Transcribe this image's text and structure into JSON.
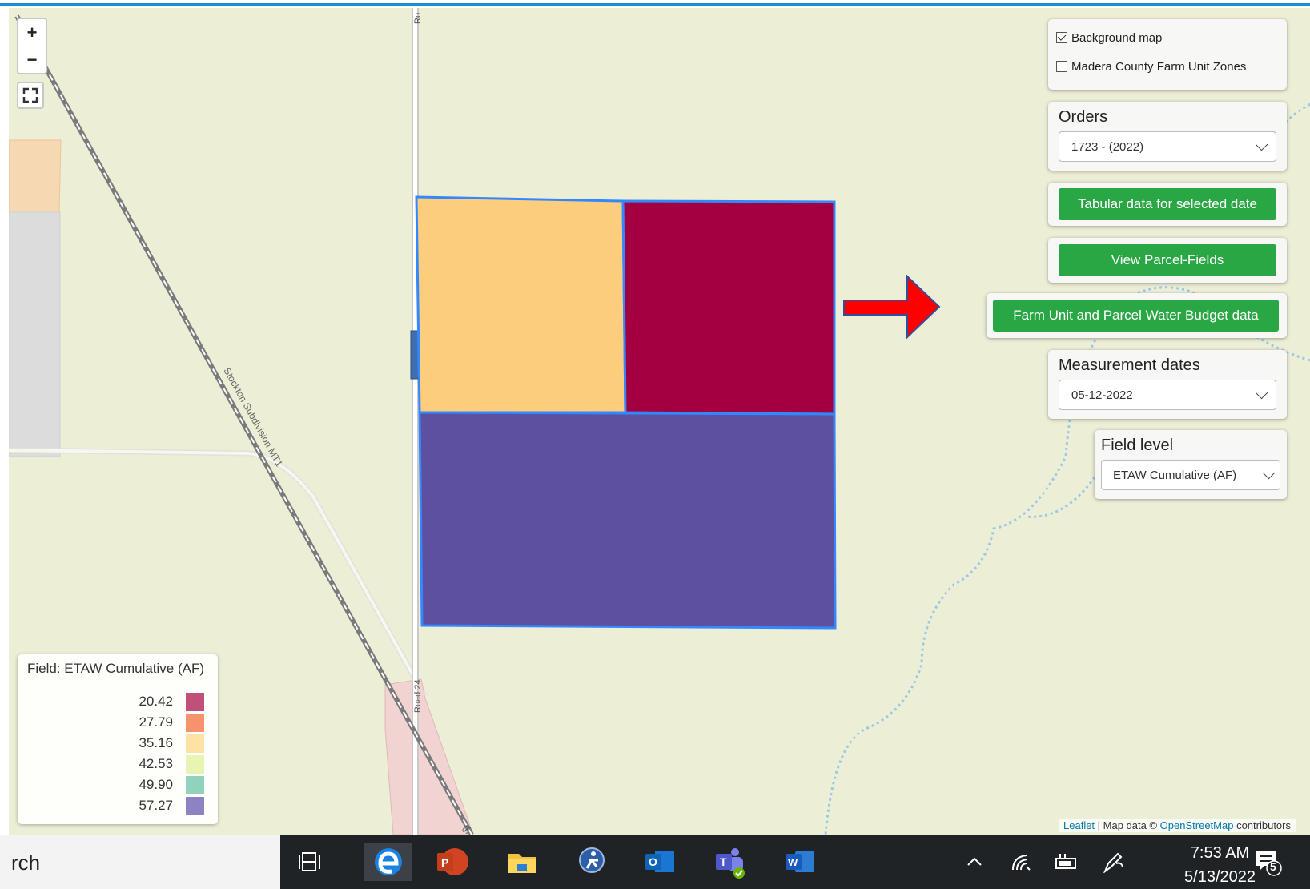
{
  "layers": {
    "background_map": {
      "label": "Background map",
      "checked": true
    },
    "farm_unit_zones": {
      "label": "Madera County Farm Unit Zones",
      "checked": false
    }
  },
  "orders": {
    "title": "Orders",
    "selected": "1723 - (2022)"
  },
  "buttons": {
    "tabular": "Tabular data for selected date",
    "parcel_fields": "View Parcel-Fields",
    "water_budget": "Farm Unit and Parcel Water Budget data"
  },
  "measurement": {
    "title": "Measurement dates",
    "selected": "05-12-2022"
  },
  "field_level": {
    "title": "Field level",
    "selected": "ETAW Cumulative (AF)"
  },
  "zoom": {
    "in": "+",
    "out": "−"
  },
  "map_labels": {
    "railway": "Stockton Subdivision MT1",
    "road": "Road 24",
    "road_top": "Ro",
    "road_bottom": "St",
    "corner": "vis"
  },
  "legend": {
    "title": "Field: ETAW Cumulative (AF)",
    "items": [
      {
        "value": "20.42",
        "color": "#c0507a"
      },
      {
        "value": "27.79",
        "color": "#f7936c"
      },
      {
        "value": "35.16",
        "color": "#fde2a4"
      },
      {
        "value": "42.53",
        "color": "#e8f4b2"
      },
      {
        "value": "49.90",
        "color": "#8fd3bd"
      },
      {
        "value": "57.27",
        "color": "#8c84c2"
      }
    ]
  },
  "fields_colors": {
    "top_left": "#fdcd7e",
    "top_right": "#a20040",
    "bottom": "#5e50a1",
    "outline": "#3388ff"
  },
  "attribution": {
    "leaflet": "Leaflet",
    "sep": " | Map data © ",
    "osm": "OpenStreetMap",
    "contrib": " contributors"
  },
  "taskbar": {
    "search_text": "rch",
    "time": "7:53 AM",
    "date": "5/13/2022",
    "notifications": "5"
  }
}
